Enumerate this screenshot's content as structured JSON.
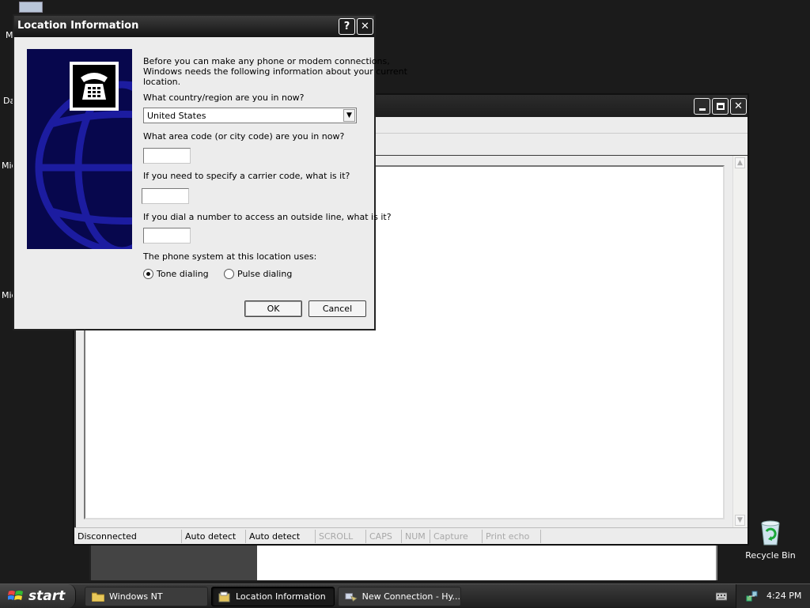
{
  "desktop": {
    "icon_labels": [
      "M",
      "Da",
      "Mic",
      "Mic"
    ],
    "recycle_bin_label": "Recycle Bin"
  },
  "background_window": {
    "status_bar": {
      "connection": "Disconnected",
      "detect1": "Auto detect",
      "detect2": "Auto detect",
      "scroll": "SCROLL",
      "caps": "CAPS",
      "num": "NUM",
      "capture": "Capture",
      "print_echo": "Print echo"
    }
  },
  "dialog": {
    "title": "Location Information",
    "help_btn": "?",
    "close_btn": "✕",
    "intro_line1": "Before you can make any phone or modem connections,",
    "intro_line2": "Windows needs the following information about your current",
    "intro_line3": "location.",
    "country_label": "What country/region are you in now?",
    "country_value": "United States",
    "area_code_label": "What area code (or city code) are you in now?",
    "area_code_value": "",
    "carrier_code_label": "If you need to specify a carrier code, what is it?",
    "carrier_code_value": "",
    "outside_line_label": "If you dial a number to access an outside line, what is it?",
    "outside_line_value": "",
    "phone_system_label": "The phone system at this location uses:",
    "tone_label": "Tone dialing",
    "pulse_label": "Pulse dialing",
    "selected_dialing": "tone",
    "ok_label": "OK",
    "cancel_label": "Cancel"
  },
  "taskbar": {
    "start_label": "start",
    "buttons": [
      {
        "label": "Windows NT",
        "icon": "folder-icon"
      },
      {
        "label": "Location Information",
        "icon": "dialog-icon"
      },
      {
        "label": "New Connection - Hy...",
        "icon": "hyperterminal-icon"
      }
    ],
    "clock": "4:24 PM"
  },
  "colors": {
    "dialog_art_bg": "#07074d",
    "title_bar": "#1f1f1f"
  }
}
